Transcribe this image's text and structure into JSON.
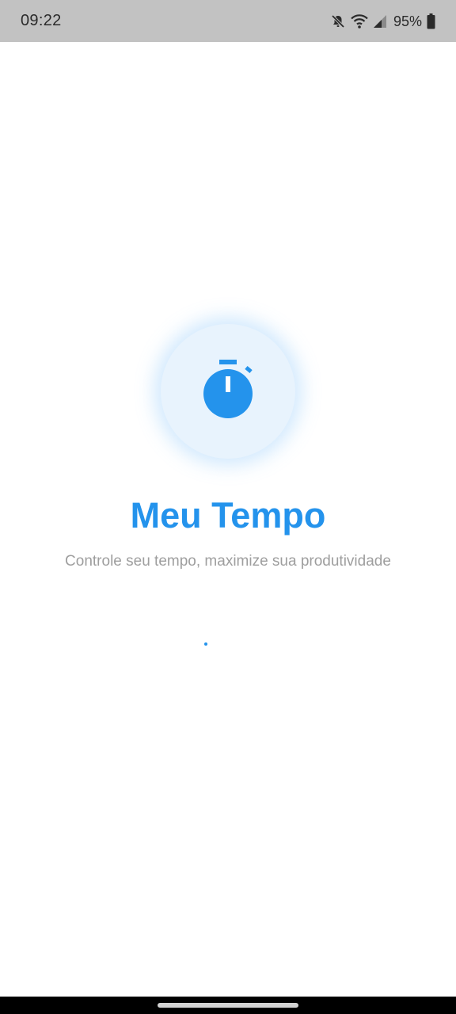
{
  "status_bar": {
    "time": "09:22",
    "battery_percent": "95%",
    "icons": [
      "mute-icon",
      "wifi-icon",
      "cell-signal-icon",
      "battery-icon"
    ]
  },
  "splash": {
    "logo_icon": "stopwatch-icon",
    "title": "Meu Tempo",
    "subtitle": "Controle seu tempo, maximize sua produtividade",
    "loading": true
  },
  "colors": {
    "primary": "#2493ec",
    "logo_background": "#e8f3fd",
    "subtitle": "#9e9e9e",
    "status_bar": "#c2c2c2"
  }
}
